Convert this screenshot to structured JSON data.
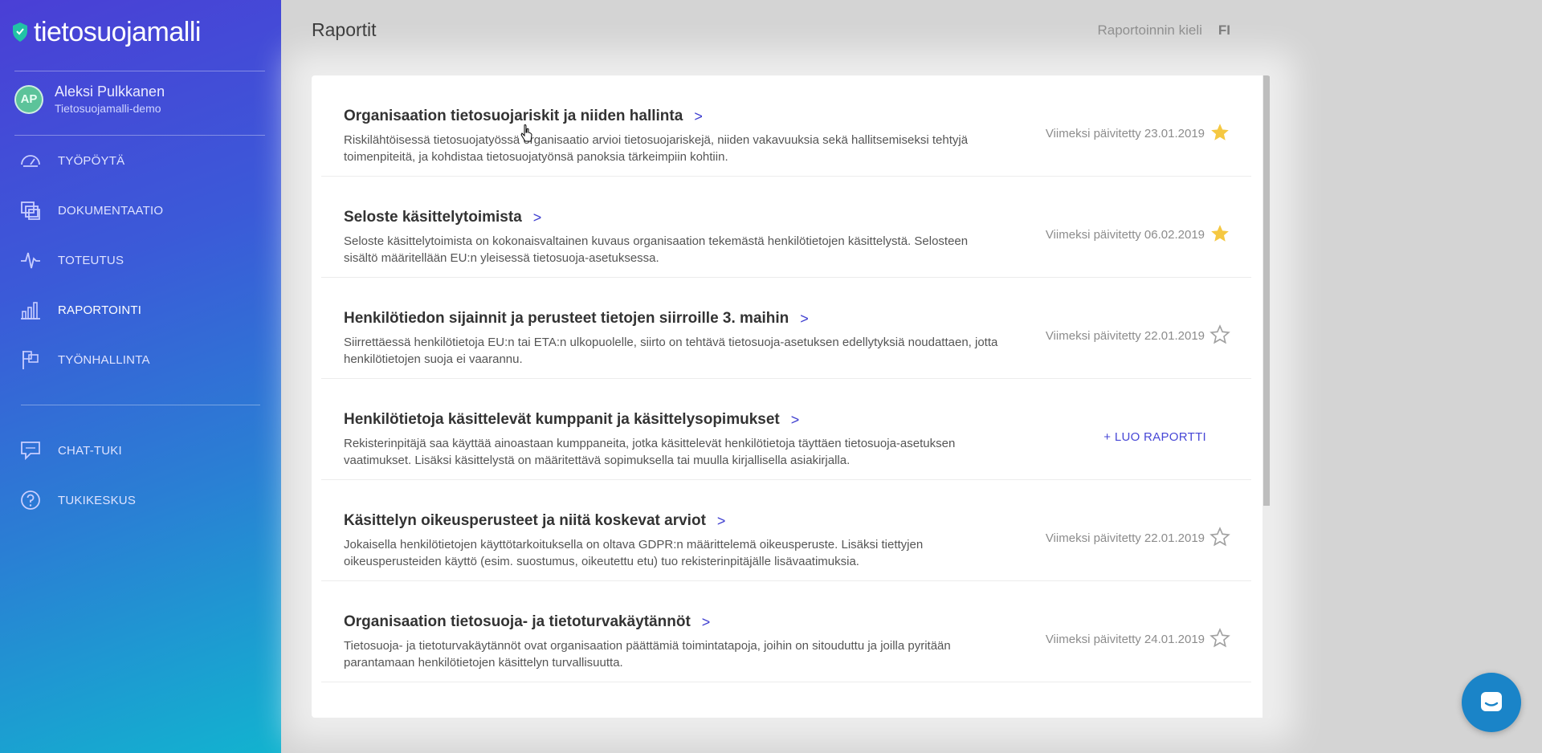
{
  "brand": {
    "name": "tietosuojamalli"
  },
  "user": {
    "initials": "AP",
    "name": "Aleksi Pulkkanen",
    "org": "Tietosuojamalli-demo"
  },
  "nav": {
    "items": [
      {
        "label": "TYÖPÖYTÄ",
        "icon": "dashboard-icon"
      },
      {
        "label": "DOKUMENTAATIO",
        "icon": "documents-icon"
      },
      {
        "label": "TOTEUTUS",
        "icon": "pulse-icon"
      },
      {
        "label": "RAPORTOINTI",
        "icon": "bar-chart-icon"
      },
      {
        "label": "TYÖNHALLINTA",
        "icon": "flag-icon"
      }
    ],
    "support": [
      {
        "label": "CHAT-TUKI",
        "icon": "chat-icon"
      },
      {
        "label": "TUKIKESKUS",
        "icon": "help-icon"
      }
    ]
  },
  "header": {
    "title": "Raportit",
    "language_label": "Raportoinnin kieli",
    "language_value": "FI"
  },
  "reports": [
    {
      "title": "Organisaation tietosuojariskit ja niiden hallinta",
      "desc": "Riskilähtöisessä tietosuojatyössä organisaatio arvioi tietosuojariskejä, niiden vakavuuksia sekä hallitsemiseksi tehtyjä toimenpiteitä, ja kohdistaa tietosuojatyönsä panoksia tärkeimpiin kohtiin.",
      "updated": "Viimeksi päivitetty 23.01.2019",
      "starred": true
    },
    {
      "title": "Seloste käsittelytoimista",
      "desc": "Seloste käsittelytoimista on kokonaisvaltainen kuvaus organisaation tekemästä henkilötietojen käsittelystä. Selosteen sisältö määritellään EU:n yleisessä tietosuoja-asetuksessa.",
      "updated": "Viimeksi päivitetty 06.02.2019",
      "starred": true
    },
    {
      "title": "Henkilötiedon sijainnit ja perusteet tietojen siirroille 3. maihin",
      "desc": "Siirrettäessä henkilötietoja EU:n tai ETA:n ulkopuolelle, siirto on tehtävä tietosuoja-asetuksen edellytyksiä noudattaen, jotta henkilötietojen suoja ei vaarannu.",
      "updated": "Viimeksi päivitetty 22.01.2019",
      "starred": false
    },
    {
      "title": "Henkilötietoja käsittelevät kumppanit ja käsittelysopimukset",
      "desc": "Rekisterinpitäjä saa käyttää ainoastaan kumppaneita, jotka käsittelevät henkilötietoja täyttäen tietosuoja-asetuksen vaatimukset. Lisäksi käsittelystä on määritettävä sopimuksella tai muulla kirjallisella asiakirjalla.",
      "create_label": "+ LUO RAPORTTI"
    },
    {
      "title": "Käsittelyn oikeusperusteet ja niitä koskevat arviot",
      "desc": "Jokaisella henkilötietojen käyttötarkoituksella on oltava GDPR:n määrittelemä oikeusperuste. Lisäksi tiettyjen oikeusperusteiden käyttö (esim. suostumus, oikeutettu etu) tuo rekisterinpitäjälle lisävaatimuksia.",
      "updated": "Viimeksi päivitetty 22.01.2019",
      "starred": false
    },
    {
      "title": "Organisaation tietosuoja- ja tietoturvakäytännöt",
      "desc": "Tietosuoja- ja tietoturvakäytännöt ovat organisaation päättämiä toimintatapoja, joihin on sitouduttu ja joilla pyritään parantamaan henkilötietojen käsittelyn turvallisuutta.",
      "updated": "Viimeksi päivitetty 24.01.2019",
      "starred": false
    }
  ],
  "colors": {
    "accent": "#4747d6",
    "star_filled": "#f5c842",
    "star_empty": "#a0a0a0"
  }
}
